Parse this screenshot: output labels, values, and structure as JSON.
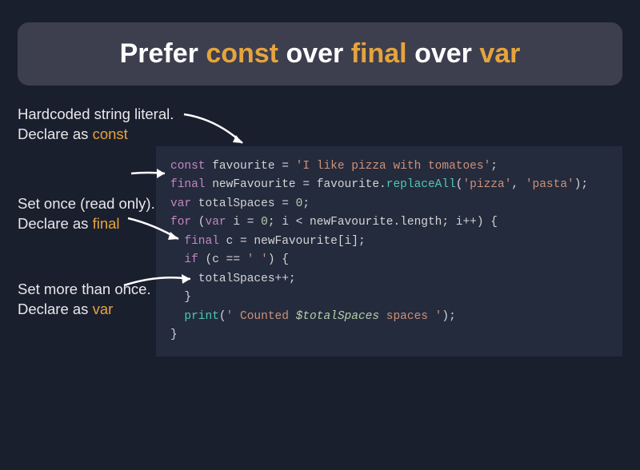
{
  "title": {
    "prefix": "Prefer ",
    "const": "const",
    "mid1": " over ",
    "final": "final",
    "mid2": " over ",
    "var": "var"
  },
  "annotations": [
    {
      "line1": "Hardcoded string literal.",
      "line2_prefix": "Declare as ",
      "keyword": "const"
    },
    {
      "line1": "Set once (read only).",
      "line2_prefix": "Declare as ",
      "keyword": "final"
    },
    {
      "line1": "Set more than once.",
      "line2_prefix": "Declare as ",
      "keyword": "var"
    }
  ],
  "code": {
    "l1_kw": "const",
    "l1_rest": " favourite = ",
    "l1_str": "'I like pizza with tomatoes'",
    "l1_end": ";",
    "l2_kw": "final",
    "l2_a": " newFavourite = favourite.",
    "l2_fn": "replaceAll",
    "l2_b": "(",
    "l2_s1": "'pizza'",
    "l2_c": ", ",
    "l2_s2": "'pasta'",
    "l2_d": ");",
    "l3_kw": "var",
    "l3_a": " totalSpaces = ",
    "l3_num": "0",
    "l3_b": ";",
    "l4_kw1": "for",
    "l4_a": " (",
    "l4_kw2": "var",
    "l4_b": " i = ",
    "l4_n1": "0",
    "l4_c": "; i < newFavourite.length; i++) {",
    "l5_kw": "final",
    "l5_a": " c = newFavourite[i];",
    "l6_kw": "if",
    "l6_a": " (c == ",
    "l6_str": "' '",
    "l6_b": ") {",
    "l7": "totalSpaces++;",
    "l8": "}",
    "l9_fn": "print",
    "l9_a": "(",
    "l9_s1": "' Counted ",
    "l9_interp": "$totalSpaces",
    "l9_s2": " spaces '",
    "l9_b": ");",
    "l10": "}"
  },
  "colors": {
    "background": "#1a1f2e",
    "banner": "#3d3f4f",
    "code_bg": "#242b3d",
    "accent": "#e6a43c",
    "keyword": "#c586c0",
    "string": "#ce9178",
    "number": "#b5cea8",
    "function": "#4ec9b0"
  }
}
